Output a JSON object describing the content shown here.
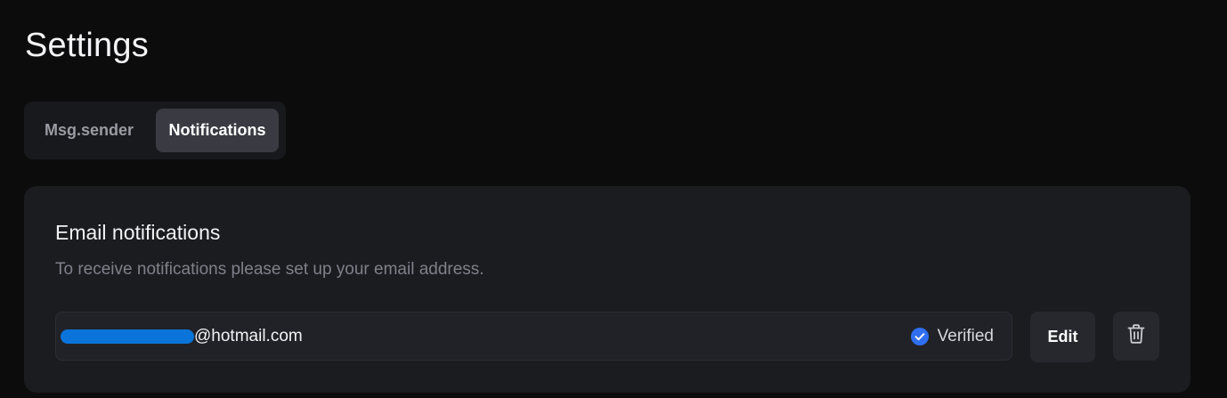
{
  "header": {
    "title": "Settings"
  },
  "tabs": [
    {
      "label": "Msg.sender",
      "active": false
    },
    {
      "label": "Notifications",
      "active": true
    }
  ],
  "email_notifications": {
    "title": "Email notifications",
    "description": "To receive notifications please set up your email address.",
    "email_visible_part": "@hotmail.com",
    "status_label": "Verified",
    "status_icon": "check-circle-icon",
    "edit_label": "Edit",
    "delete_icon": "trash-icon"
  },
  "colors": {
    "background": "#0c0c0d",
    "card": "#1b1c20",
    "active_tab": "#3a3b42",
    "verified_accent": "#2f6ff0",
    "redaction": "#0a74da"
  }
}
